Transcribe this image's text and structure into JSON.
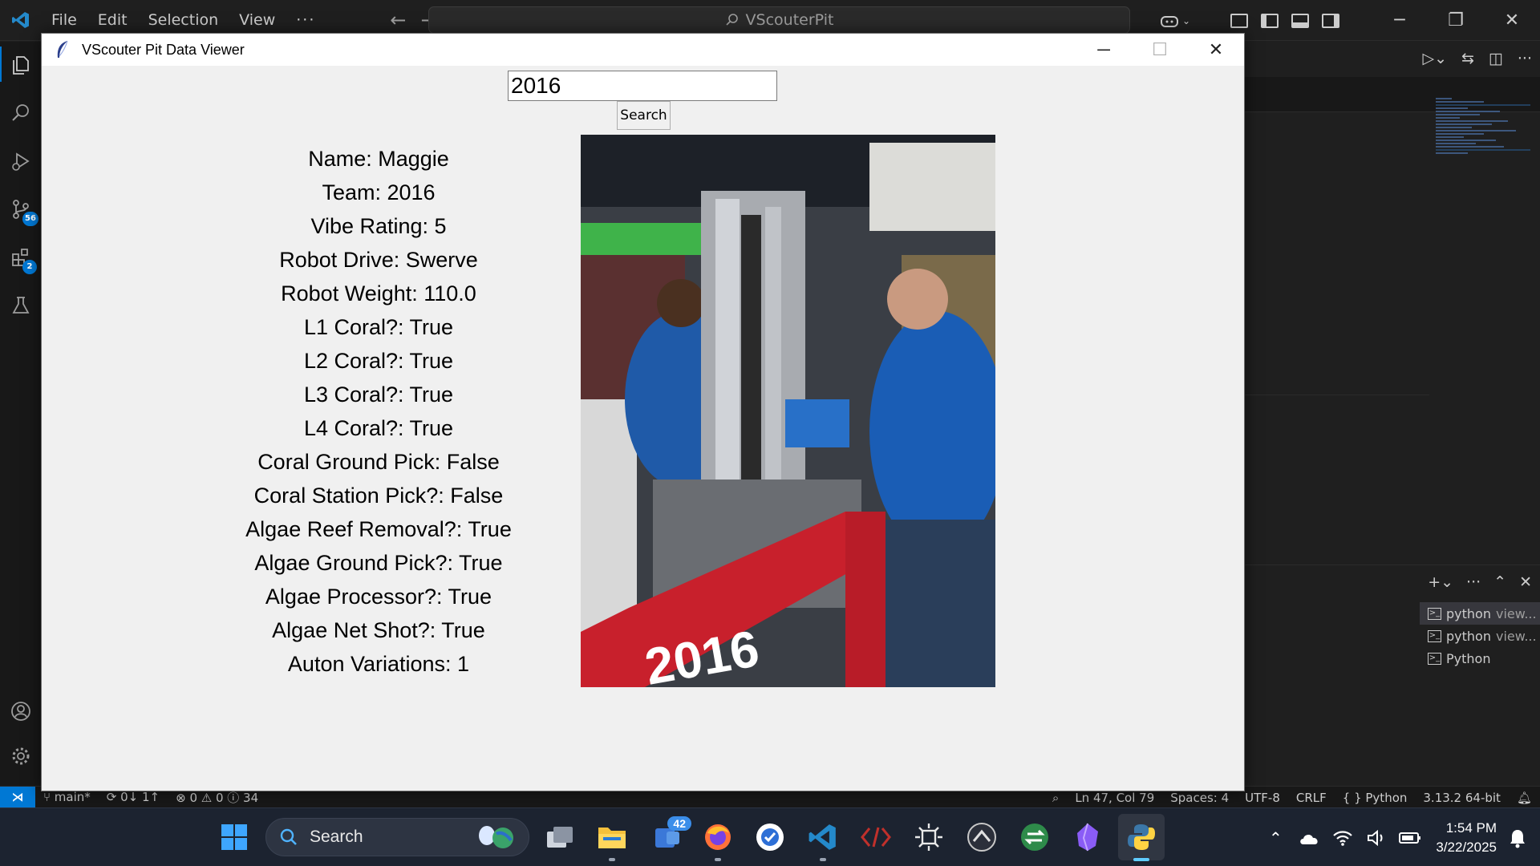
{
  "vscode": {
    "menu": [
      "File",
      "Edit",
      "Selection",
      "View",
      "···"
    ],
    "command_center": "VScouterPit",
    "badges": {
      "source_control": "56",
      "extensions": "2"
    },
    "terminals": [
      {
        "name": "python",
        "detail": "view..."
      },
      {
        "name": "python",
        "detail": "view..."
      },
      {
        "name": "Python",
        "detail": ""
      }
    ],
    "status": {
      "branch": "main*",
      "sync": "0↓ 1↑",
      "problems": "⊗ 0 ⚠ 0 ⓘ 34",
      "cursor": "Ln 47, Col 79",
      "spaces": "Spaces: 4",
      "encoding": "UTF-8",
      "eol": "CRLF",
      "language": "{ } Python",
      "interpreter": "3.13.2 64-bit"
    }
  },
  "app": {
    "title": "VScouter Pit Data Viewer",
    "search_value": "2016",
    "search_button": "Search",
    "fields": [
      "Name: Maggie",
      "Team: 2016",
      "Vibe Rating: 5",
      "Robot Drive: Swerve",
      "Robot Weight: 110.0",
      "L1 Coral?: True",
      "L2 Coral?: True",
      "L3 Coral?: True",
      "L4 Coral?: True",
      "Coral Ground Pick: False",
      "Coral Station Pick?: False",
      "Algae Reef Removal?: True",
      "Algae Ground Pick?: True",
      "Algae Processor?: True",
      "Algae Net Shot?: True",
      "Auton Variations: 1"
    ],
    "photo_text": "2016"
  },
  "taskbar": {
    "search": "Search",
    "teams_badge": "42",
    "time": "1:54 PM",
    "date": "3/22/2025"
  }
}
